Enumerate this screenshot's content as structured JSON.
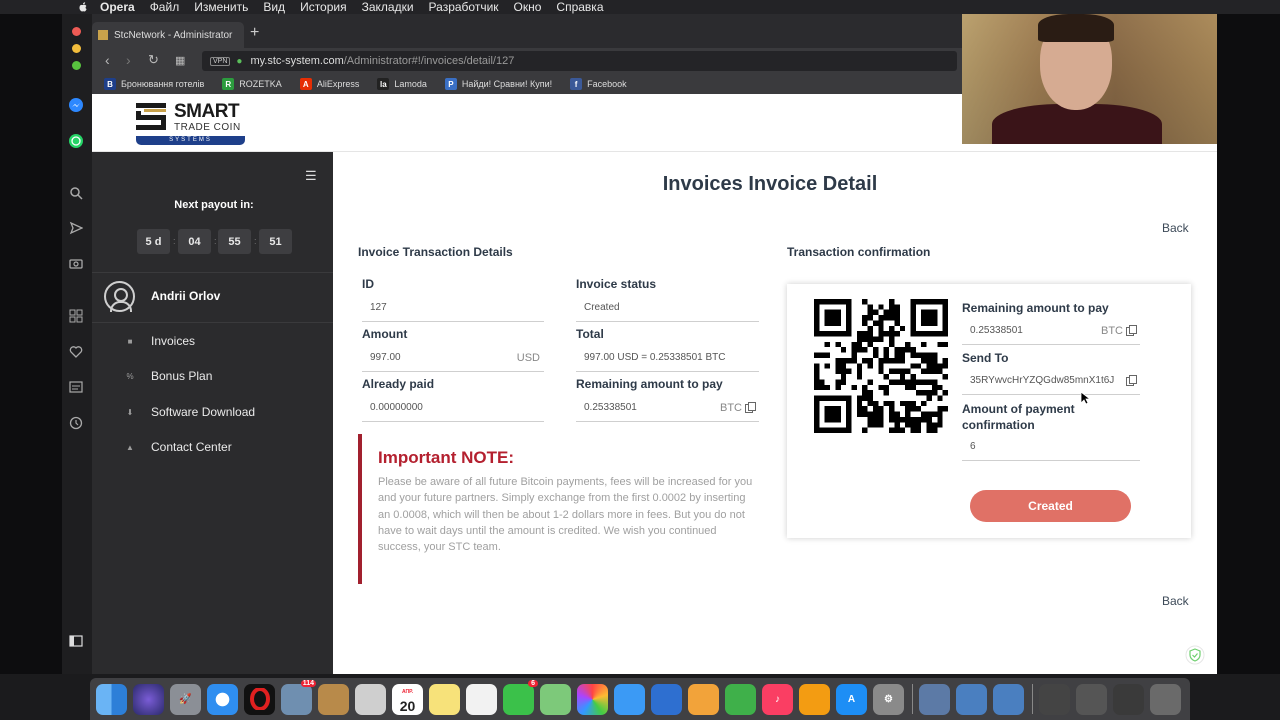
{
  "menubar": {
    "items": [
      "Opera",
      "Файл",
      "Изменить",
      "Вид",
      "История",
      "Закладки",
      "Разработчик",
      "Окно",
      "Справка"
    ]
  },
  "browser": {
    "tab_title": "StcNetwork - Administrator",
    "url_host": "my.stc-system.com",
    "url_path": "/Administrator#!/invoices/detail/127",
    "vpn_label": "VPN",
    "bookmarks": [
      {
        "label": "Бронювання готелів",
        "icon": "B",
        "color": "#1e3f8a"
      },
      {
        "label": "ROZETKA",
        "icon": "R",
        "color": "#2c9c3e"
      },
      {
        "label": "AliExpress",
        "icon": "A",
        "color": "#e62e04"
      },
      {
        "label": "Lamoda",
        "icon": "la",
        "color": "#222222"
      },
      {
        "label": "Найди! Сравни! Купи!",
        "icon": "P",
        "color": "#3a6fc4"
      },
      {
        "label": "Facebook",
        "icon": "f",
        "color": "#3b5998"
      }
    ]
  },
  "logo": {
    "title": "SMART",
    "subtitle": "TRADE COIN",
    "bar": "SYSTEMS"
  },
  "sidebar": {
    "payout_title": "Next payout in:",
    "countdown": [
      "5 d",
      "04",
      "55",
      "51"
    ],
    "user_name": "Andrii Orlov",
    "items": [
      {
        "label": "Invoices",
        "icon": "home-icon"
      },
      {
        "label": "Bonus Plan",
        "icon": "percent-icon"
      },
      {
        "label": "Software Download",
        "icon": "download-icon"
      },
      {
        "label": "Contact Center",
        "icon": "building-icon"
      }
    ]
  },
  "page": {
    "title": "Invoices Invoice Detail",
    "back_label": "Back",
    "left_section_title": "Invoice Transaction Details",
    "right_section_title": "Transaction confirmation",
    "fields": {
      "id_label": "ID",
      "id_value": "127",
      "status_label": "Invoice status",
      "status_value": "Created",
      "amount_label": "Amount",
      "amount_value": "997.00",
      "amount_currency": "USD",
      "total_label": "Total",
      "total_value": "997.00  USD = 0.25338501 BTC",
      "paid_label": "Already paid",
      "paid_value": "0.00000000",
      "remaining_label": "Remaining amount to pay",
      "remaining_value": "0.25338501",
      "remaining_currency": "BTC"
    },
    "note": {
      "title": "Important NOTE:",
      "body": "Please be aware of all future Bitcoin payments, fees will be increased for you and your future partners. Simply exchange from the first 0.0002 by inserting an 0.0008, which will then be about 1-2 dollars more in fees. But you do not have to wait days until the amount is credited. We wish you continued success, your STC team."
    },
    "confirmation": {
      "remaining_label": "Remaining amount to pay",
      "remaining_value": "0.25338501",
      "remaining_currency": "BTC",
      "send_to_label": "Send To",
      "send_to_value": "35RYwvcHrYZQGdw85mnX1t6J",
      "confirmations_label": "Amount of payment confirmation",
      "confirmations_value": "6",
      "button_label": "Created"
    }
  },
  "dock": {
    "badge_mail": "114",
    "badge_facetime": "6",
    "calendar_month": "АПР.",
    "calendar_day": "20"
  },
  "colors": {
    "accent_button": "#e07166",
    "note_red": "#b4202f",
    "sidebar_bg": "#2b2b2d",
    "logo_blue": "#1e3f8a"
  }
}
